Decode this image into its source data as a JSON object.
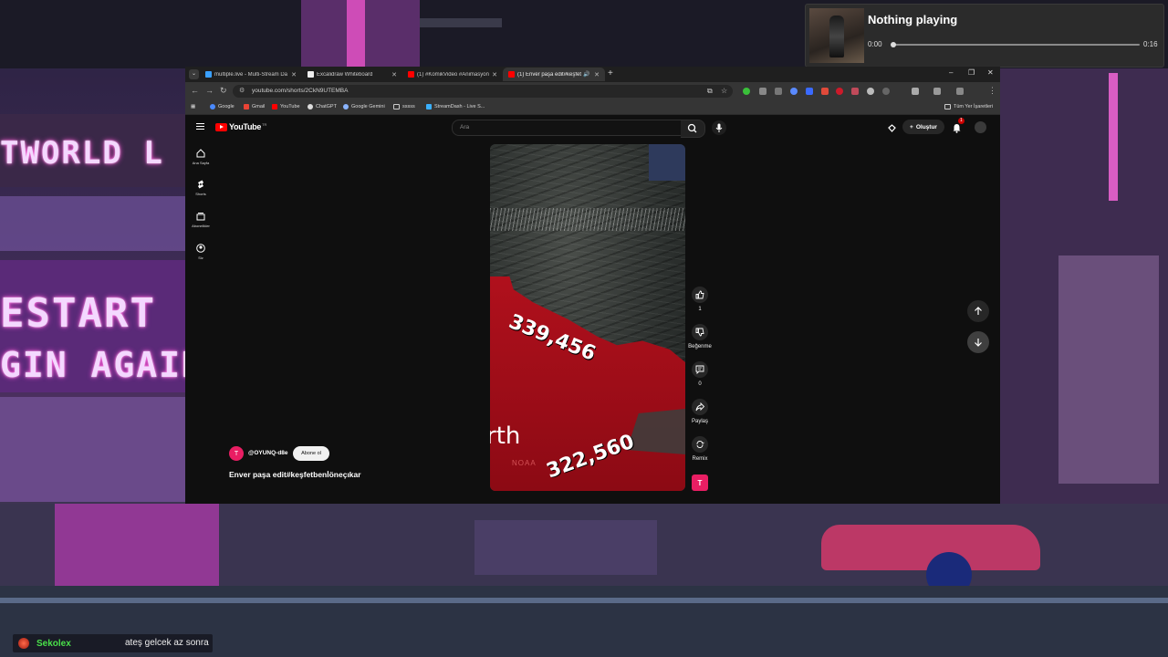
{
  "media": {
    "title": "Nothing playing",
    "elapsed": "0:00",
    "duration": "0:16",
    "progress": 0.0
  },
  "browser": {
    "tabs": [
      {
        "label": "multiple.live - Multi-Stream Da",
        "active": false
      },
      {
        "label": "Excalidraw Whiteboard",
        "active": false
      },
      {
        "label": "(1) #KomikVideo #Animasyon",
        "active": false
      },
      {
        "label": "(1) Enver paşa edit#keşfetb",
        "active": true
      }
    ],
    "url": "youtube.com/shorts/2CkN9UTEMBA",
    "bookmarks": [
      "Google",
      "Gmail",
      "YouTube",
      "ChatGPT",
      "Google Gemini",
      "sssss",
      "StreamDash - Live S..."
    ],
    "all_bookmarks": "Tüm Yer İşaretleri"
  },
  "youtube": {
    "logo_text": "YouTube",
    "region": "TR",
    "search_placeholder": "Ara",
    "create_label": "Oluştur",
    "notification_count": "1",
    "sidebar": [
      {
        "label": "Ana Sayfa"
      },
      {
        "label": "Shorts"
      },
      {
        "label": "Abonelikler"
      },
      {
        "label": "Siz"
      }
    ],
    "video": {
      "overlay_number_1": "339,456",
      "overlay_word": "rth",
      "overlay_number_2": "322,560",
      "overlay_credit": "NOAA"
    },
    "actions": {
      "like_count": "1",
      "dislike_label": "Beğenme",
      "comment_count": "0",
      "share_label": "Paylaş",
      "remix_label": "Remix"
    },
    "channel": {
      "avatar_letter": "T",
      "handle": "@OYUNQ-d8e",
      "subscribe_label": "Abone ol"
    },
    "video_title": "Enver paşa edit#keşfetbenİöneçıkar"
  },
  "chat": {
    "username": "Sekolex",
    "message": "ateş gelcek az sonra"
  },
  "background": {
    "sign_1": "TWORLD L",
    "sign_2": "ESTART",
    "sign_3": "GIN AGAIN"
  },
  "colors": {
    "youtube_red": "#ff0000",
    "accent_pink": "#e91e63",
    "chat_user": "#4ae04a"
  }
}
